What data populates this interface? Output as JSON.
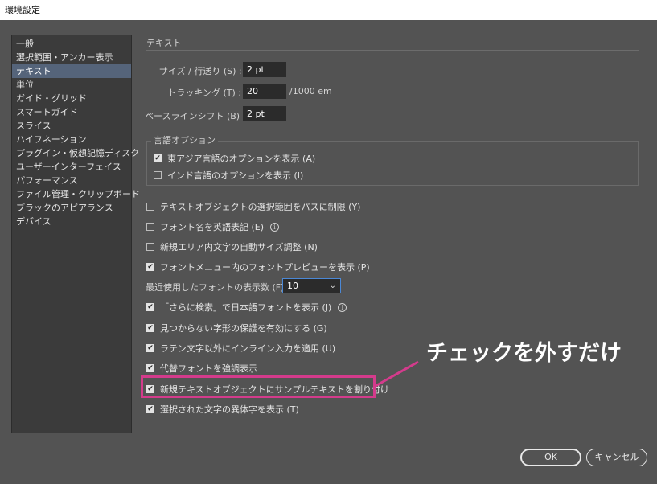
{
  "window": {
    "title": "環境設定"
  },
  "sidebar": {
    "items": [
      {
        "label": "一般",
        "active": false
      },
      {
        "label": "選択範囲・アンカー表示",
        "active": false
      },
      {
        "label": "テキスト",
        "active": true
      },
      {
        "label": "単位",
        "active": false
      },
      {
        "label": "ガイド・グリッド",
        "active": false
      },
      {
        "label": "スマートガイド",
        "active": false
      },
      {
        "label": "スライス",
        "active": false
      },
      {
        "label": "ハイフネーション",
        "active": false
      },
      {
        "label": "プラグイン・仮想記憶ディスク",
        "active": false
      },
      {
        "label": "ユーザーインターフェイス",
        "active": false
      },
      {
        "label": "パフォーマンス",
        "active": false
      },
      {
        "label": "ファイル管理・クリップボード",
        "active": false
      },
      {
        "label": "ブラックのアピアランス",
        "active": false
      },
      {
        "label": "デバイス",
        "active": false
      }
    ]
  },
  "text_panel": {
    "section_title": "テキスト",
    "size_leading": {
      "label": "サイズ / 行送り (S) :",
      "value": "2 pt"
    },
    "tracking": {
      "label": "トラッキング (T) :",
      "value": "20",
      "unit": "/1000 em"
    },
    "baseline_shift": {
      "label": "ベースラインシフト (B) :",
      "value": "2 pt"
    },
    "language_options": {
      "title": "言語オプション",
      "east_asian": {
        "label": "東アジア言語のオプションを表示 (A)",
        "checked": true
      },
      "indic": {
        "label": "インド言語のオプションを表示 (I)",
        "checked": false
      }
    },
    "checkboxes": [
      {
        "label": "テキストオブジェクトの選択範囲をパスに制限 (Y)",
        "checked": false
      },
      {
        "label": "フォント名を英語表記 (E)",
        "checked": false
      },
      {
        "label": "新規エリア内文字の自動サイズ調整 (N)",
        "checked": false
      },
      {
        "label": "フォントメニュー内のフォントプレビューを表示 (P)",
        "checked": true
      }
    ],
    "recent_fonts": {
      "label": "最近使用したフォントの表示数 (F) :",
      "value": "10"
    },
    "checkboxes2": [
      {
        "label": "「さらに検索」で日本語フォントを表示 (J)",
        "checked": true
      },
      {
        "label": "見つからない字形の保護を有効にする (G)",
        "checked": true
      },
      {
        "label": "ラテン文字以外にインライン入力を適用 (U)",
        "checked": true
      },
      {
        "label": "代替フォントを強調表示",
        "checked": true
      },
      {
        "label": "新規テキストオブジェクトにサンプルテキストを割り付け",
        "checked": true
      },
      {
        "label": "選択された文字の異体字を表示 (T)",
        "checked": true
      }
    ]
  },
  "annotation": {
    "text": "チェックを外すだけ",
    "color": "#d43b8c"
  },
  "buttons": {
    "ok": "OK",
    "cancel": "キャンセル"
  },
  "icons": {
    "check": "check-icon",
    "info": "info-icon",
    "chevron": "chevron-down-icon"
  }
}
